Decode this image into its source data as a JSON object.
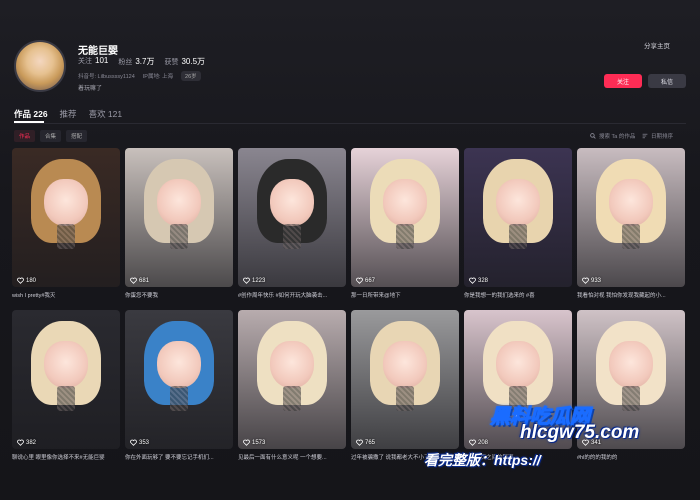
{
  "profile": {
    "name": "无能巨婴",
    "follow_label": "关注",
    "follow_count": "101",
    "fans_label": "粉丝",
    "fans_count": "3.7万",
    "likes_label": "获赞",
    "likes_count": "30.5万",
    "douyin_id": "抖音号: Lilbussssy1124",
    "ip_location": "IP属地: 上海",
    "age": "26岁",
    "bio": "着玩嘛了"
  },
  "header": {
    "share_label": "分享主页",
    "follow_button": "关注",
    "message_button": "私信"
  },
  "tabs": [
    {
      "label": "作品 226"
    },
    {
      "label": "推荐"
    },
    {
      "label": "喜欢 121"
    }
  ],
  "subtabs": [
    {
      "label": "作品"
    },
    {
      "label": "合集"
    },
    {
      "label": "搭配"
    }
  ],
  "search_works_placeholder": "搜索 Ta 的作品",
  "sort_label": "日期排序",
  "videos": [
    {
      "likes": "180",
      "caption": "wish I pretty#我灭",
      "tone": "#3a2a24",
      "hair": "#b98a52"
    },
    {
      "likes": "681",
      "caption": "你蛋您不要我",
      "tone": "#c8c0bc",
      "hair": "#d6c8b2"
    },
    {
      "likes": "1223",
      "caption": "#创作周年快乐 #如何开玩大脑袭击...",
      "tone": "#8a8690",
      "hair": "#2a2a2a"
    },
    {
      "likes": "667",
      "caption": "那一日所带来@地下",
      "tone": "#e6d2d8",
      "hair": "#ecdcb8"
    },
    {
      "likes": "328",
      "caption": "你是我想一的我们选来的 #喜",
      "tone": "#3c3452",
      "hair": "#e8d4ae"
    },
    {
      "likes": "933",
      "caption": "我看怕对视 我怕你发现我藏起的小...",
      "tone": "#c8bcc0",
      "hair": "#f0dcb4"
    },
    {
      "likes": "382",
      "caption": "聊说心里 眼里像你选择不来#无能巨婴",
      "tone": "#2a2a30",
      "hair": "#ead8b6"
    },
    {
      "likes": "353",
      "caption": "你在外面玩够了 要不要忘记手机们...",
      "tone": "#3a3a40",
      "hair": "#3a82c8"
    },
    {
      "likes": "1573",
      "caption": "见最后一面有什么意义呢 一个想要...",
      "tone": "#b8acae",
      "hair": "#eee0c2"
    },
    {
      "likes": "765",
      "caption": "过年被骗撒了 说我都老大不小了",
      "tone": "#9a9a9c",
      "hair": "#e8d6b4"
    },
    {
      "likes": "208",
      "caption": "相关网页之间的距离 ...",
      "tone": "#d8c4cc",
      "hair": "#f0e0c4"
    },
    {
      "likes": "341",
      "caption": "#hl的的的我的的",
      "tone": "#cfc2c6",
      "hair": "#f2e2c8"
    }
  ],
  "watermarks": {
    "brand": "黑料吃瓜网",
    "url_prefix": "看完整版：https://",
    "url_domain": "hlcgw75.com"
  },
  "colors": {
    "accent": "#fe2c55",
    "background": "#161619",
    "panel": "#1e1e24"
  },
  "icons": {
    "like": "heart-outline-icon",
    "search": "search-icon",
    "sort": "sort-lines-icon"
  }
}
